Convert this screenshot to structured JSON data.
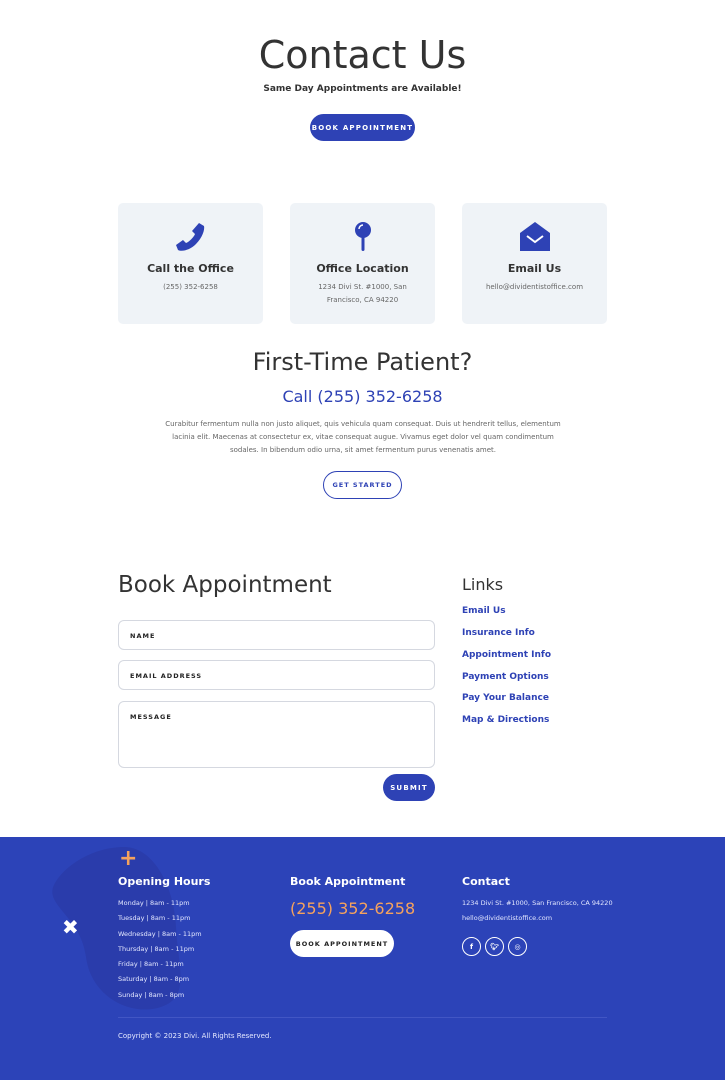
{
  "hero": {
    "title": "Contact Us",
    "subtitle": "Same Day Appointments are Available!",
    "button": "BOOK APPOINTMENT"
  },
  "cards": [
    {
      "icon": "phone-icon",
      "title": "Call the Office",
      "text": "(255) 352-6258"
    },
    {
      "icon": "map-pin-icon",
      "title": "Office Location",
      "text": "1234 Divi St. #1000, San Francisco, CA 94220"
    },
    {
      "icon": "envelope-open-icon",
      "title": "Email Us",
      "text": "hello@dividentistoffice.com"
    }
  ],
  "first_time": {
    "title": "First-Time Patient?",
    "phone": "Call (255) 352-6258",
    "body": "Curabitur fermentum nulla non justo aliquet, quis vehicula quam consequat. Duis ut hendrerit tellus, elementum lacinia elit. Maecenas at consectetur ex, vitae consequat augue. Vivamus eget dolor vel quam condimentum sodales. In bibendum odio urna, sit amet fermentum purus venenatis amet.",
    "button": "GET STARTED"
  },
  "form": {
    "title": "Book Appointment",
    "name": "NAME",
    "email": "EMAIL ADDRESS",
    "message": "MESSAGE",
    "submit": "SUBMIT"
  },
  "links": {
    "title": "Links",
    "items": [
      "Email Us",
      "Insurance Info",
      "Appointment Info",
      "Payment Options",
      "Pay Your Balance",
      "Map & Directions"
    ]
  },
  "footer": {
    "hours_title": "Opening Hours",
    "hours": [
      "Monday | 8am - 11pm",
      "Tuesday | 8am - 11pm",
      "Wednesday | 8am - 11pm",
      "Thursday | 8am - 11pm",
      "Friday | 8am - 11pm",
      "Saturday | 8am - 8pm",
      "Sunday | 8am - 8pm"
    ],
    "book_title": "Book Appointment",
    "phone": "(255) 352-6258",
    "book_button": "BOOK APPOINTMENT",
    "contact_title": "Contact",
    "address": "1234 Divi St. #1000, San Francisco, CA 94220",
    "email": "hello@dividentistoffice.com",
    "social": [
      "f",
      "t",
      "ig"
    ],
    "copyright": "Copyright © 2023 Divi. All Rights Reserved."
  },
  "colors": {
    "accent": "#2e42b5",
    "footer_bg": "#2c43b8",
    "orange": "#f5a25d",
    "card_bg": "#eff3f7"
  }
}
